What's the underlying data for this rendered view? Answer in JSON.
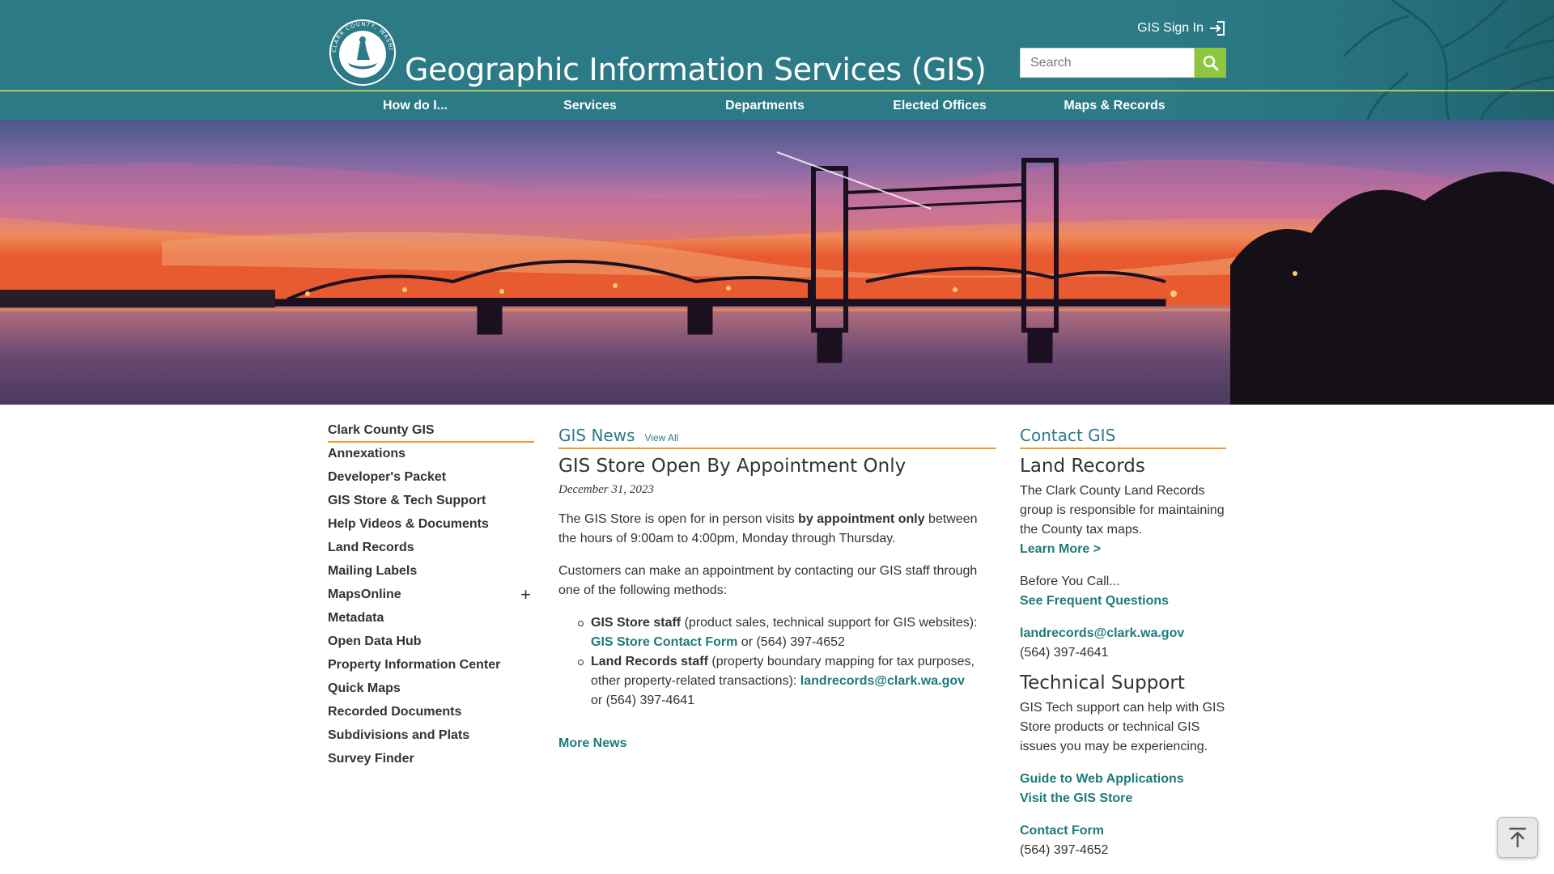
{
  "header": {
    "title": "Geographic Information Services (GIS)",
    "logo_text": "CLARK COUNTY, WASHINGTON",
    "signin_label": "GIS Sign In",
    "search_placeholder": "Search"
  },
  "nav": [
    "How do I...",
    "Services",
    "Departments",
    "Elected Offices",
    "Maps & Records"
  ],
  "sidebar": {
    "items": [
      {
        "label": "Clark County GIS",
        "active": true
      },
      {
        "label": "Annexations"
      },
      {
        "label": "Developer's Packet"
      },
      {
        "label": "GIS Store & Tech Support"
      },
      {
        "label": "Help Videos & Documents"
      },
      {
        "label": "Land Records"
      },
      {
        "label": "Mailing Labels"
      },
      {
        "label": "MapsOnline",
        "expand": "+"
      },
      {
        "label": "Metadata"
      },
      {
        "label": "Open Data Hub"
      },
      {
        "label": "Property Information Center"
      },
      {
        "label": "Quick Maps"
      },
      {
        "label": "Recorded Documents"
      },
      {
        "label": "Subdivisions and Plats"
      },
      {
        "label": "Survey Finder"
      }
    ]
  },
  "news": {
    "section_title": "GIS News",
    "view_all": "View All",
    "headline": "GIS Store Open By Appointment Only",
    "date": "December 31, 2023",
    "p1_a": "The GIS Store is open for in person visits ",
    "p1_b": "by appointment only",
    "p1_c": " between the hours of 9:00am to 4:00pm, Monday through Thursday.",
    "p2": "Customers can make an appointment by contacting our GIS staff through one of the following methods:",
    "b1_strong": "GIS Store staff",
    "b1_text": " (product sales, technical support for GIS websites):",
    "b1_link": "GIS Store Contact Form",
    "b1_tail": " or (564) 397-4652",
    "b2_strong": "Land Records staff",
    "b2_text": " (property boundary mapping for tax purposes, other property-related transactions):  ",
    "b2_link": "landrecords@clark.wa.gov",
    "b2_tail": "or (564) 397-4641",
    "more": "More News"
  },
  "contact": {
    "section_title": "Contact GIS",
    "land_title": "Land Records",
    "land_desc": "The Clark County Land Records group is responsible for maintaining the County tax maps.",
    "learn_more": "Learn More >",
    "before": "Before You Call...",
    "faq": "See Frequent Questions",
    "land_email": "landrecords@clark.wa.gov",
    "land_phone": "(564) 397-4641",
    "tech_title": "Technical Support",
    "tech_desc": "GIS Tech support can help with GIS Store products or technical GIS issues you may be experiencing.",
    "guide": "Guide to Web Applications",
    "visit": "Visit the GIS Store",
    "form": "Contact Form",
    "tech_phone": "(564) 397-4652"
  },
  "colors": {
    "header_bg": "#2b7a86",
    "accent_green": "#8dc63f",
    "accent_orange": "#f39c27",
    "link": "#1f7a7a"
  },
  "icons": [
    "signin-icon",
    "search-icon",
    "back-to-top-icon"
  ]
}
